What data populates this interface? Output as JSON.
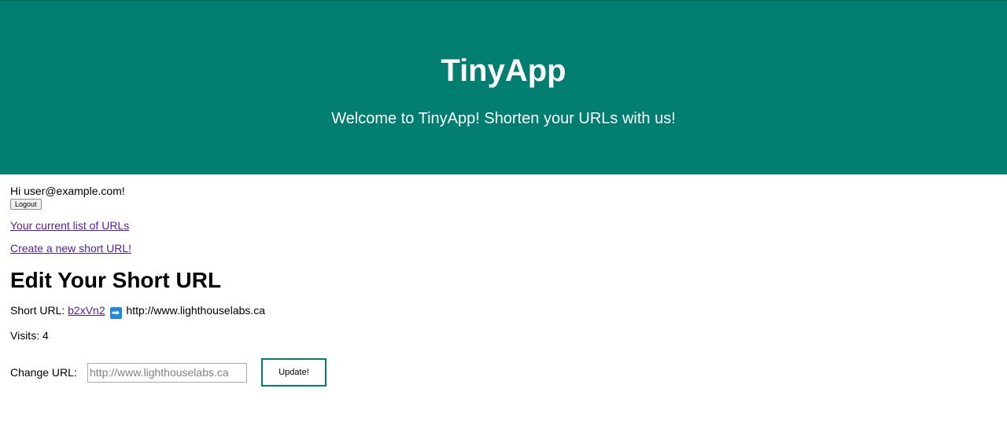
{
  "header": {
    "title": "TinyApp",
    "subtitle": "Welcome to TinyApp! Shorten your URLs with us!"
  },
  "user": {
    "greeting": "Hi user@example.com!",
    "logout_label": "Logout"
  },
  "nav": {
    "urls_link": "Your current list of URLs",
    "new_link": "Create a new short URL!"
  },
  "edit": {
    "heading": "Edit Your Short URL",
    "short_label": "Short URL:",
    "short_id": "b2xVn2",
    "arrow_icon": "right-arrow-emoji",
    "arrow_glyph": "➡",
    "long_url": "http://www.lighthouselabs.ca",
    "visits_text": "Visits: 4",
    "change_label": "Change URL:",
    "input_placeholder": "http://www.lighthouselabs.ca",
    "update_label": "Update!"
  },
  "colors": {
    "header_bg": "#007f70",
    "link": "#551ab0",
    "arrow_bg": "#1e88e5"
  }
}
